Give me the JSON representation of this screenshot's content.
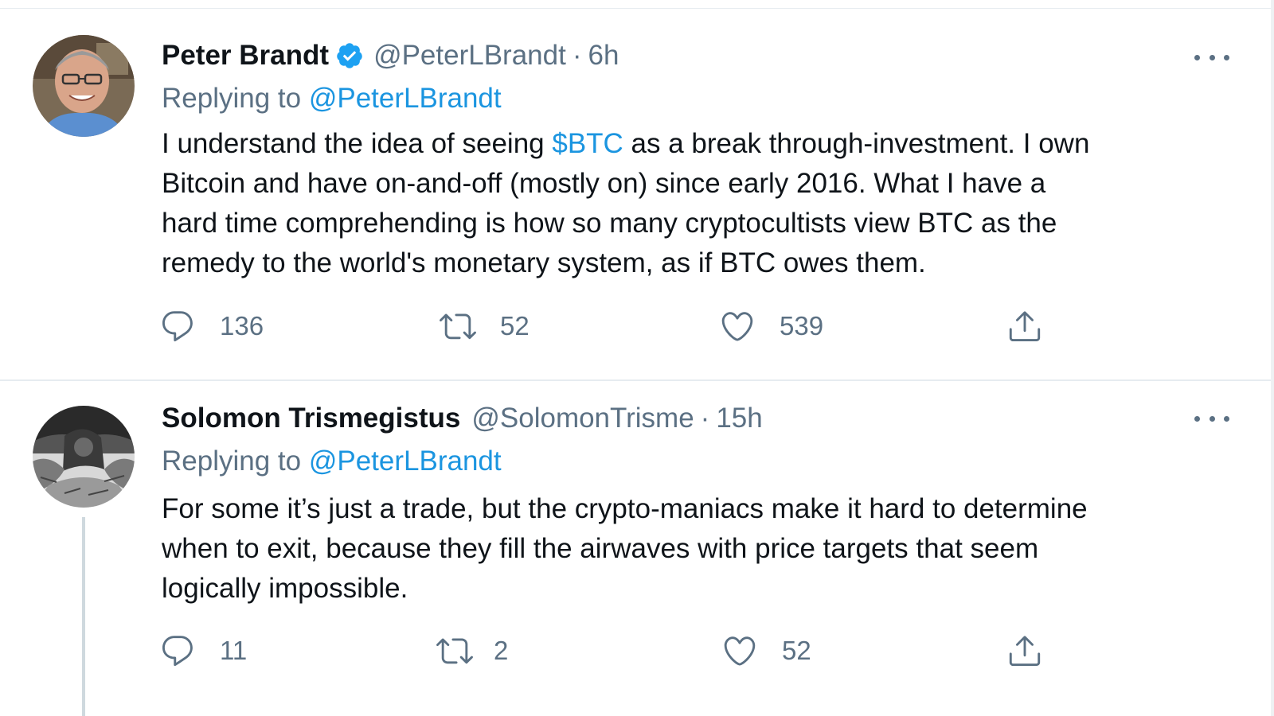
{
  "tweets": [
    {
      "name": "Peter Brandt",
      "verified": true,
      "handle": "@PeterLBrandt",
      "dot": "·",
      "time": "6h",
      "replying_prefix": "Replying to",
      "replying_to": "@PeterLBrandt",
      "body": {
        "line1_before": "I understand the idea of seeing ",
        "line1_cashtag": "$BTC",
        "line1_after": " as a break through-investment. I own",
        "line2": "Bitcoin and have on-and-off (mostly on) since early 2016. What I have a",
        "line3": "hard time comprehending is how so many cryptocultists view BTC as the",
        "line4": "remedy to the world's monetary system, as if BTC owes them."
      },
      "replies": "136",
      "retweets": "52",
      "likes": "539"
    },
    {
      "name": "Solomon Trismegistus",
      "verified": false,
      "handle": "@SolomonTrisme",
      "dot": "·",
      "time": "15h",
      "replying_prefix": "Replying to",
      "replying_to": "@PeterLBrandt",
      "body": {
        "line1": "For some it’s just a trade, but the crypto-maniacs make it hard to determine",
        "line2": "when to exit, because they fill the airwaves with price targets that seem",
        "line3": "logically impossible."
      },
      "replies": "11",
      "retweets": "2",
      "likes": "52"
    }
  ],
  "icons": {
    "reply": "reply-icon",
    "retweet": "retweet-icon",
    "like": "heart-icon",
    "share": "share-icon",
    "more": "more-icon",
    "verified": "verified-badge-icon"
  },
  "colors": {
    "link": "#1b95e0",
    "secondary_text": "#5b7083",
    "primary_text": "#0f1419",
    "verified": "#1da1f2",
    "divider": "#e6ecf0"
  }
}
